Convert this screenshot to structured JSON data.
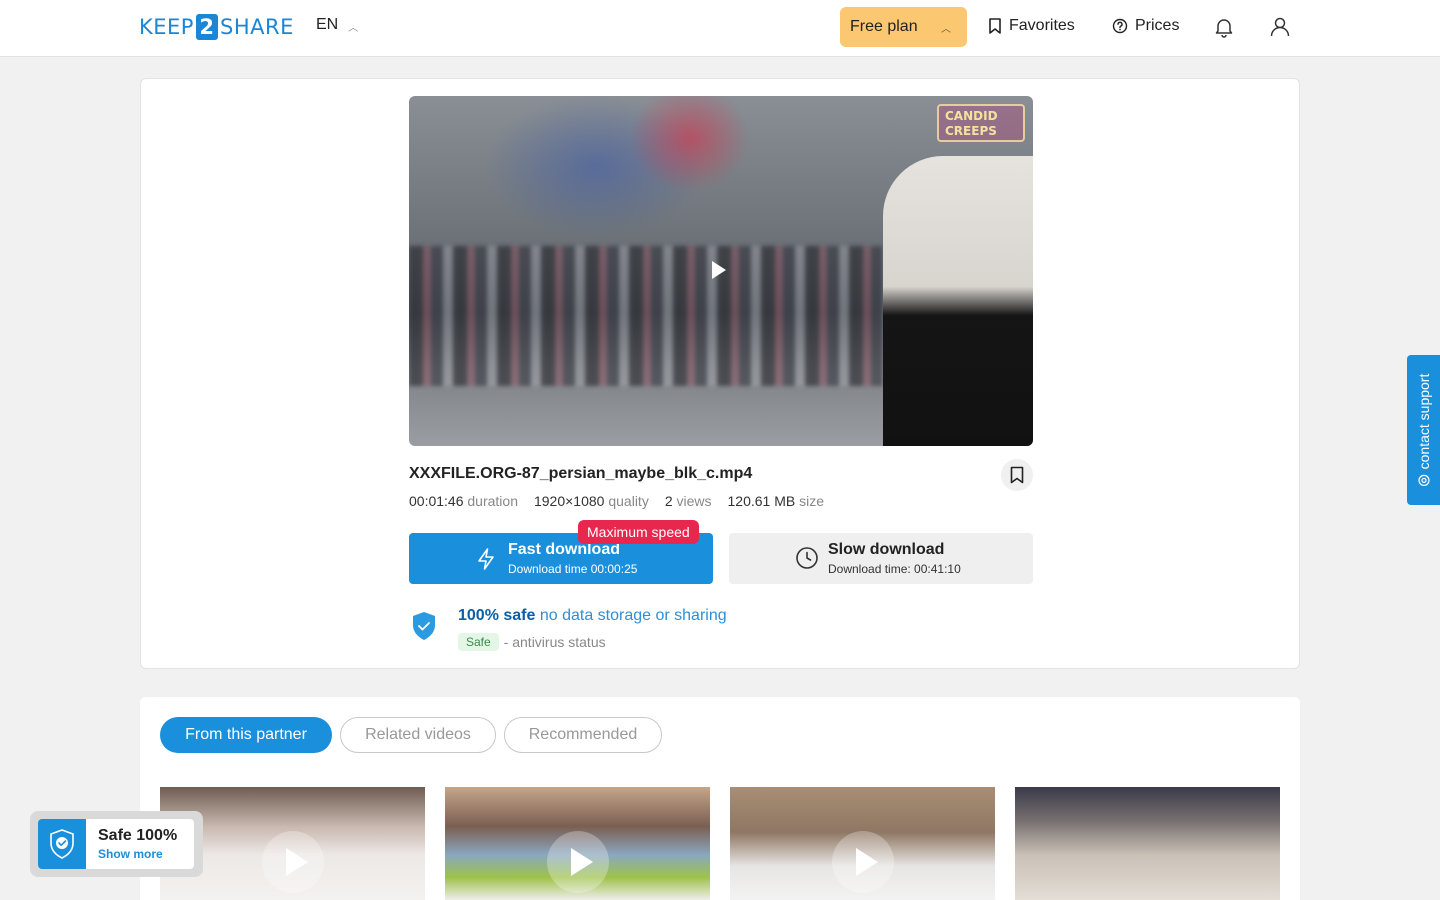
{
  "header": {
    "logo_left": "KEEP",
    "logo_mid": "2",
    "logo_right": "SHARE",
    "language": "EN",
    "plan_label": "Free plan",
    "favorites_label": "Favorites",
    "prices_label": "Prices"
  },
  "video": {
    "watermark_line1": "CANDID",
    "watermark_line2": "CREEPS"
  },
  "file": {
    "name": "XXXFILE.ORG-87_persian_maybe_blk_c.mp4",
    "duration_value": "00:01:46",
    "duration_label": "duration",
    "quality_value": "1920×1080",
    "quality_label": "quality",
    "views_value": "2",
    "views_label": "views",
    "size_value": "120.61 MB",
    "size_label": "size"
  },
  "download": {
    "fast_title": "Fast download",
    "fast_time": "Download time 00:00:25",
    "max_speed_badge": "Maximum speed",
    "slow_title": "Slow download",
    "slow_time": "Download time: 00:41:10"
  },
  "safety": {
    "headline_bold": "100% safe",
    "headline_rest": "no data storage or sharing",
    "antivirus_badge": "Safe",
    "antivirus_text": "- antivirus status"
  },
  "tabs": [
    {
      "label": "From this partner"
    },
    {
      "label": "Related videos"
    },
    {
      "label": "Recommended"
    }
  ],
  "safe_widget": {
    "title": "Safe 100%",
    "link": "Show more"
  },
  "support": {
    "label": "contact support"
  },
  "colors": {
    "accent": "#1a8fdc",
    "plan": "#fbc770",
    "badge_red": "#e8274f"
  }
}
